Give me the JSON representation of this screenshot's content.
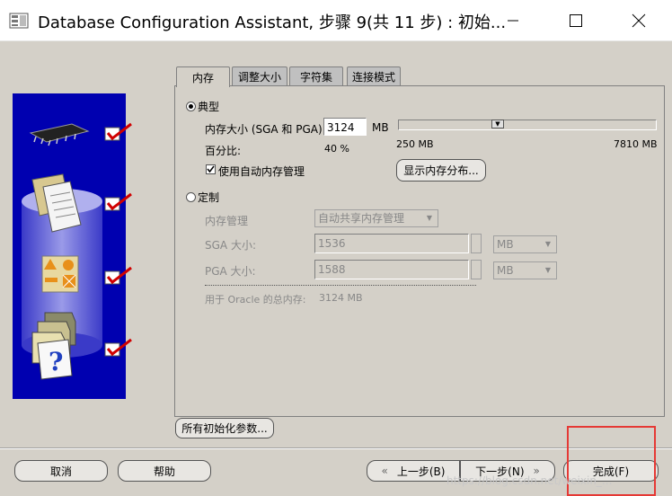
{
  "window": {
    "title": "Database Configuration Assistant, 步骤 9(共 11 步) : 初始...",
    "minimize_icon": "minimize-icon",
    "maximize_icon": "maximize-icon",
    "close_icon": "close-icon"
  },
  "tabs": [
    {
      "label": "内存",
      "active": true
    },
    {
      "label": "调整大小",
      "active": false
    },
    {
      "label": "字符集",
      "active": false
    },
    {
      "label": "连接模式",
      "active": false
    }
  ],
  "typical": {
    "radio_label": "典型",
    "selected": true,
    "memory_size_label": "内存大小 (SGA 和 PGA):",
    "memory_size_value": "3124",
    "memory_unit": "MB",
    "slider_min": "250 MB",
    "slider_max": "7810 MB",
    "slider_fraction": 0.38,
    "percent_label": "百分比:",
    "percent_value": "40 %",
    "auto_memory_label": "使用自动内存管理",
    "auto_memory_checked": true,
    "show_distribution_button": "显示内存分布..."
  },
  "custom": {
    "radio_label": "定制",
    "selected": false,
    "memory_mgmt_label": "内存管理",
    "memory_mgmt_value": "自动共享内存管理",
    "sga_label": "SGA 大小:",
    "sga_value": "1536",
    "sga_unit": "MB",
    "pga_label": "PGA 大小:",
    "pga_value": "1588",
    "pga_unit": "MB",
    "total_label": "用于 Oracle 的总内存:",
    "total_value": "3124 MB"
  },
  "all_params_button": "所有初始化参数...",
  "footer": {
    "cancel": "取消",
    "help": "帮助",
    "back": "上一步(B)",
    "next": "下一步(N)",
    "finish": "完成(F)"
  },
  "watermark": "https://blog.csdn.net/weixin_...",
  "colors": {
    "left_panel": "#0000b0",
    "highlight_box": "#e53935",
    "check_mark": "#d00000"
  }
}
